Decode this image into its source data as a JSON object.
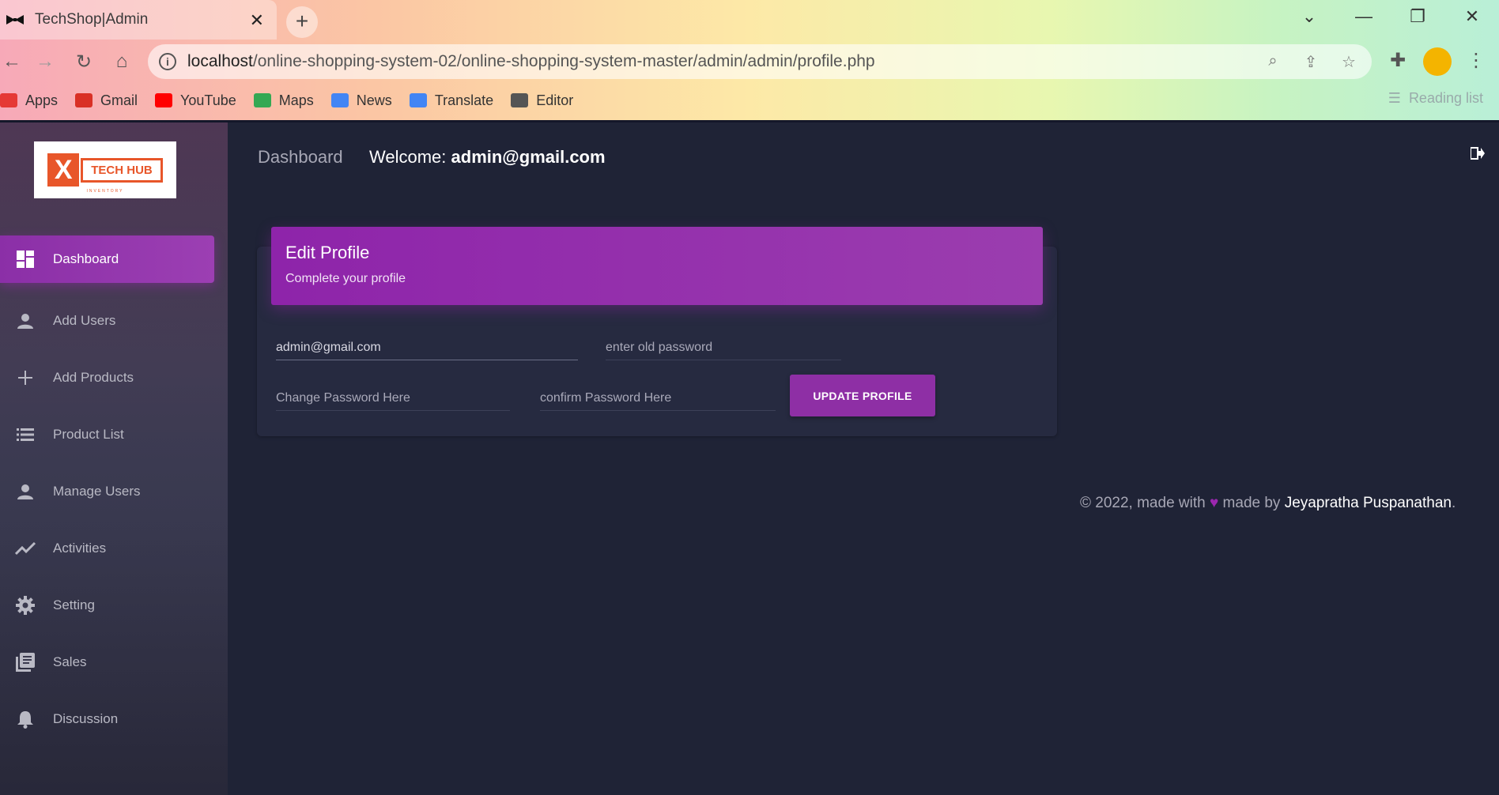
{
  "browser": {
    "tab_title": "TechShop|Admin",
    "url_host": "localhost",
    "url_path": "/online-shopping-system-02/online-shopping-system-master/admin/admin/profile.php",
    "bookmarks": [
      {
        "label": "Apps",
        "icon": "apps-grid-icon",
        "color": "#e53935"
      },
      {
        "label": "Gmail",
        "icon": "gmail-icon",
        "color": "#d93025"
      },
      {
        "label": "YouTube",
        "icon": "youtube-icon",
        "color": "#ff0000"
      },
      {
        "label": "Maps",
        "icon": "maps-icon",
        "color": "#34a853"
      },
      {
        "label": "News",
        "icon": "news-icon",
        "color": "#4285f4"
      },
      {
        "label": "Translate",
        "icon": "translate-icon",
        "color": "#4285f4"
      },
      {
        "label": "Editor",
        "icon": "editor-icon",
        "color": "#555555"
      }
    ],
    "reading_list": "Reading list"
  },
  "sidebar": {
    "logo_text": "TECH HUB",
    "logo_sub": "INVENTORY",
    "items": [
      {
        "label": "Dashboard",
        "icon": "dashboard-icon",
        "active": true
      },
      {
        "label": "Add Users",
        "icon": "person-icon"
      },
      {
        "label": "Add Products",
        "icon": "plus-icon"
      },
      {
        "label": "Product List",
        "icon": "list-icon"
      },
      {
        "label": "Manage Users",
        "icon": "person-icon"
      },
      {
        "label": "Activities",
        "icon": "trending-icon"
      },
      {
        "label": "Setting",
        "icon": "gear-icon"
      },
      {
        "label": "Sales",
        "icon": "library-books-icon"
      },
      {
        "label": "Discussion",
        "icon": "bell-icon"
      }
    ]
  },
  "topbar": {
    "title": "Dashboard",
    "welcome_prefix": "Welcome: ",
    "welcome_user": "admin@gmail.com"
  },
  "profile_card": {
    "title": "Edit Profile",
    "subtitle": "Complete your profile",
    "email_value": "admin@gmail.com",
    "old_password_placeholder": "enter old password",
    "new_password_placeholder": "Change Password Here",
    "confirm_password_placeholder": "confirm Password Here",
    "update_button": "UPDATE PROFILE"
  },
  "footer": {
    "prefix": "© 2022, made with ",
    "heart": "♥",
    "middle": " made by ",
    "author": "Jeyapratha Puspanathan",
    "suffix": "."
  },
  "colors": {
    "accent": "#9c27b0",
    "page_bg": "#1f2336",
    "card_bg": "#262a40"
  }
}
